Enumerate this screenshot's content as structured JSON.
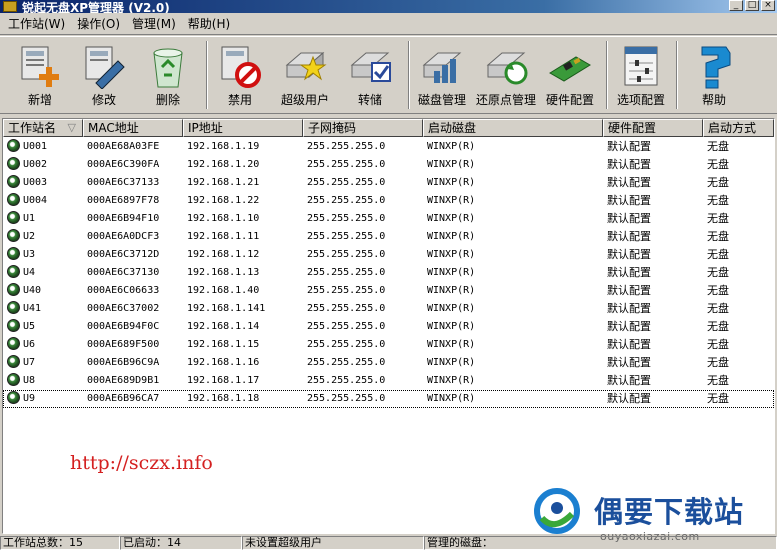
{
  "window": {
    "title": "锐起无盘XP管理器 (V2.0)"
  },
  "menu": [
    {
      "label": "工作站(W)"
    },
    {
      "label": "操作(O)"
    },
    {
      "label": "管理(M)"
    },
    {
      "label": "帮助(H)"
    }
  ],
  "toolbar": [
    {
      "label": "新增",
      "icon": "add-workstation-icon"
    },
    {
      "label": "修改",
      "icon": "edit-workstation-icon"
    },
    {
      "label": "删除",
      "icon": "recycle-bin-icon"
    },
    {
      "label": "禁用",
      "icon": "disable-icon"
    },
    {
      "label": "超级用户",
      "icon": "super-user-star-icon"
    },
    {
      "label": "转储",
      "icon": "dump-disk-icon"
    },
    {
      "label": "磁盘管理",
      "icon": "disk-management-icon"
    },
    {
      "label": "还原点管理",
      "icon": "restore-point-icon"
    },
    {
      "label": "硬件配置",
      "icon": "hardware-card-icon"
    },
    {
      "label": "选项配置",
      "icon": "options-settings-icon"
    },
    {
      "label": "帮助",
      "icon": "help-icon"
    }
  ],
  "table": {
    "columns": [
      "工作站名",
      "MAC地址",
      "IP地址",
      "子网掩码",
      "启动磁盘",
      "硬件配置",
      "启动方式"
    ],
    "rows": [
      [
        "U001",
        "000AE68A03FE",
        "192.168.1.19",
        "255.255.255.0",
        "WINXP(R)",
        "默认配置",
        "无盘"
      ],
      [
        "U002",
        "000AE6C390FA",
        "192.168.1.20",
        "255.255.255.0",
        "WINXP(R)",
        "默认配置",
        "无盘"
      ],
      [
        "U003",
        "000AE6C37133",
        "192.168.1.21",
        "255.255.255.0",
        "WINXP(R)",
        "默认配置",
        "无盘"
      ],
      [
        "U004",
        "000AE6897F78",
        "192.168.1.22",
        "255.255.255.0",
        "WINXP(R)",
        "默认配置",
        "无盘"
      ],
      [
        "U1",
        "000AE6B94F10",
        "192.168.1.10",
        "255.255.255.0",
        "WINXP(R)",
        "默认配置",
        "无盘"
      ],
      [
        "U2",
        "000AE6A0DCF3",
        "192.168.1.11",
        "255.255.255.0",
        "WINXP(R)",
        "默认配置",
        "无盘"
      ],
      [
        "U3",
        "000AE6C3712D",
        "192.168.1.12",
        "255.255.255.0",
        "WINXP(R)",
        "默认配置",
        "无盘"
      ],
      [
        "U4",
        "000AE6C37130",
        "192.168.1.13",
        "255.255.255.0",
        "WINXP(R)",
        "默认配置",
        "无盘"
      ],
      [
        "U40",
        "000AE6C06633",
        "192.168.1.40",
        "255.255.255.0",
        "WINXP(R)",
        "默认配置",
        "无盘"
      ],
      [
        "U41",
        "000AE6C37002",
        "192.168.1.141",
        "255.255.255.0",
        "WINXP(R)",
        "默认配置",
        "无盘"
      ],
      [
        "U5",
        "000AE6B94F0C",
        "192.168.1.14",
        "255.255.255.0",
        "WINXP(R)",
        "默认配置",
        "无盘"
      ],
      [
        "U6",
        "000AE689F500",
        "192.168.1.15",
        "255.255.255.0",
        "WINXP(R)",
        "默认配置",
        "无盘"
      ],
      [
        "U7",
        "000AE6B96C9A",
        "192.168.1.16",
        "255.255.255.0",
        "WINXP(R)",
        "默认配置",
        "无盘"
      ],
      [
        "U8",
        "000AE689D9B1",
        "192.168.1.17",
        "255.255.255.0",
        "WINXP(R)",
        "默认配置",
        "无盘"
      ],
      [
        "U9",
        "000AE6B96CA7",
        "192.168.1.18",
        "255.255.255.0",
        "WINXP(R)",
        "默认配置",
        "无盘"
      ]
    ],
    "selected_row": 14
  },
  "watermark": {
    "url": "http://sczx.info",
    "logo_text": "偶要下载站",
    "logo_sub": "ouyaoxiazai.com"
  },
  "status": {
    "total": "工作站总数：15",
    "started": "已启动：14",
    "superuser": "未设置超级用户",
    "disk": "管理的磁盘："
  },
  "colors": {
    "accent_blue": "#0a246a",
    "watermark_red": "#d42020",
    "logo_blue": "#1b4f9c"
  }
}
